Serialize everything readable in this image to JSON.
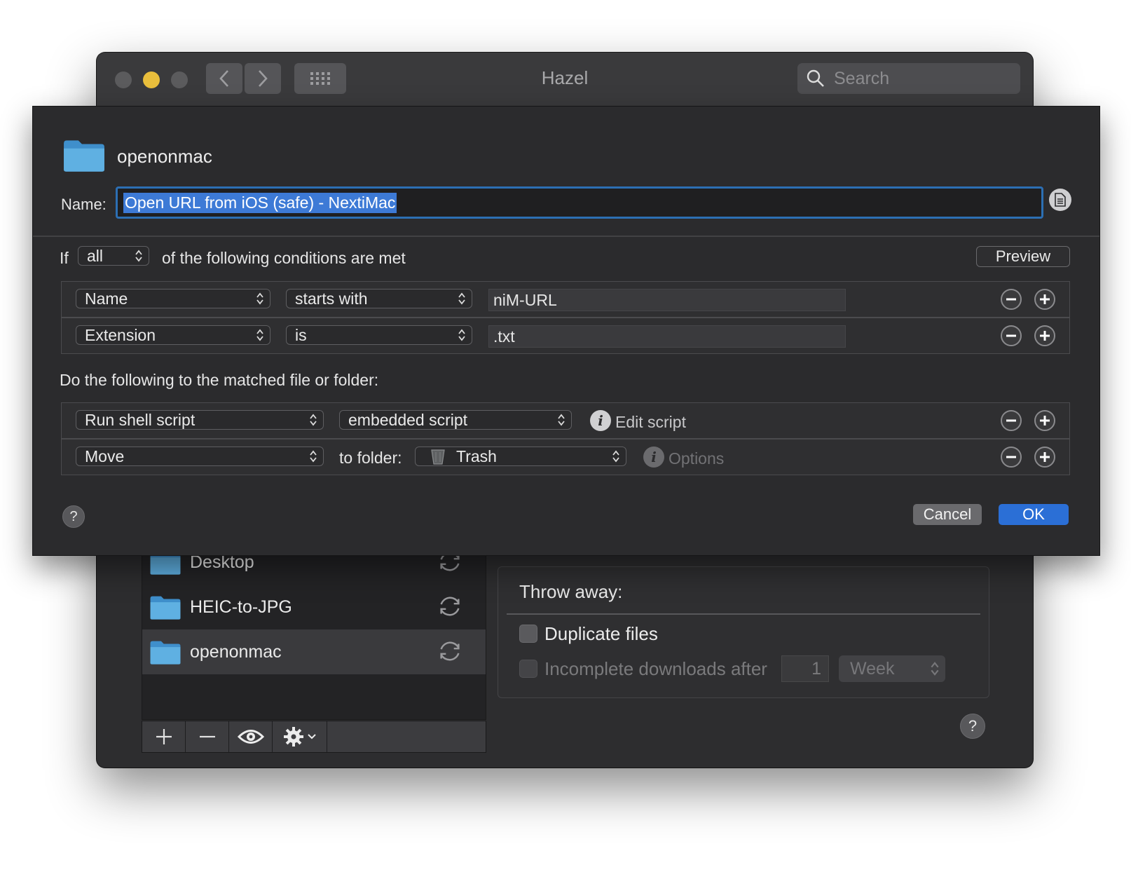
{
  "window": {
    "title": "Hazel",
    "search_placeholder": "Search"
  },
  "folders": [
    {
      "label": "Desktop"
    },
    {
      "label": "HEIC-to-JPG"
    },
    {
      "label": "openonmac"
    }
  ],
  "throw_away": {
    "title": "Throw away:",
    "duplicate_label": "Duplicate files",
    "incomplete_label": "Incomplete downloads after",
    "incomplete_value": "1",
    "incomplete_unit": "Week"
  },
  "help_label": "?",
  "sheet": {
    "folder_name": "openonmac",
    "name_label": "Name:",
    "name_value": "Open URL from iOS (safe) - NextiMac",
    "if_label": "If",
    "match_mode": "all",
    "conditions_text": "of the following conditions are met",
    "preview_label": "Preview",
    "conditions": [
      {
        "attribute": "Name",
        "operator": "starts with",
        "value": "niM-URL"
      },
      {
        "attribute": "Extension",
        "operator": "is",
        "value": ".txt"
      }
    ],
    "actions_text": "Do the following to the matched file or folder:",
    "actions": {
      "action1": "Run shell script",
      "script_source": "embedded script",
      "edit_script": "Edit script",
      "action2": "Move",
      "to_folder_label": "to folder:",
      "folder_target": "Trash",
      "options_label": "Options"
    },
    "cancel_label": "Cancel",
    "ok_label": "OK",
    "help_label": "?"
  },
  "colors": {
    "accent": "#2b6fd6",
    "selection": "#3d7ad6",
    "folder_blue": "#5aa7da",
    "minimize_yellow": "#e9be3c"
  }
}
